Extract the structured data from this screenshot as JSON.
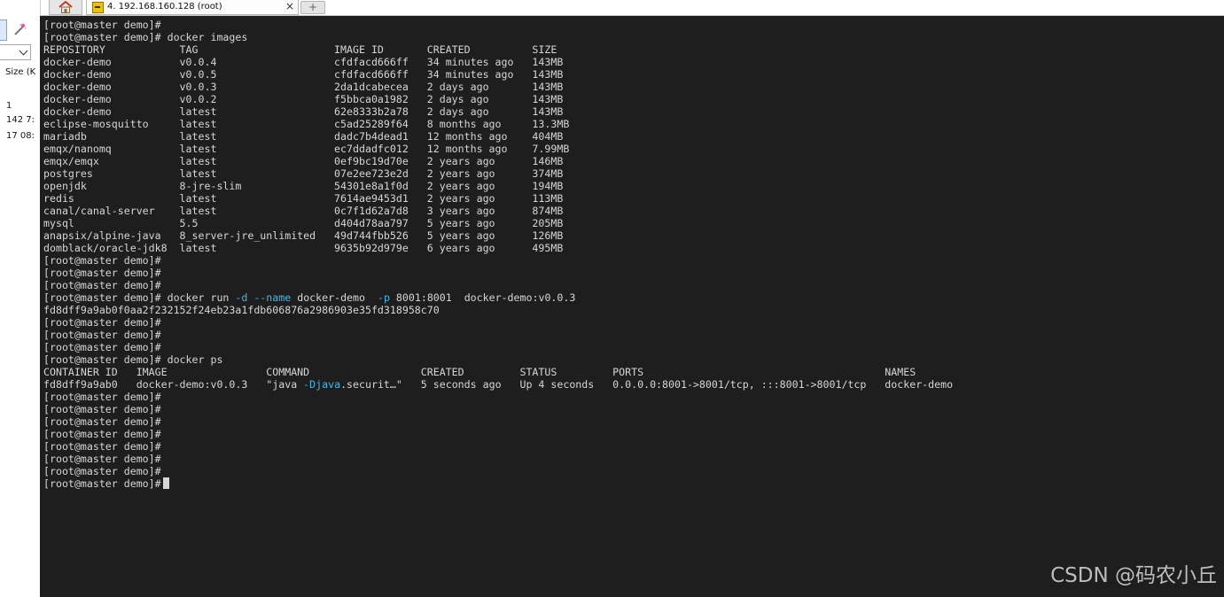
{
  "tabs": {
    "home_icon": "home-icon",
    "active_title": "4. 192.168.160.128 (root)",
    "close_glyph": "×",
    "new_tab_glyph": "+"
  },
  "sidebar": {
    "size_label": "Size (K",
    "rows": [
      "1",
      "142 7:",
      "17 08:"
    ]
  },
  "terminal": {
    "prompt": "[root@master demo]#",
    "lines": [
      "[root@master demo]#",
      "[root@master demo]# docker images",
      "REPOSITORY            TAG                      IMAGE ID       CREATED          SIZE",
      "docker-demo           v0.0.4                   cfdfacd666ff   34 minutes ago   143MB",
      "docker-demo           v0.0.5                   cfdfacd666ff   34 minutes ago   143MB",
      "docker-demo           v0.0.3                   2da1dcabecea   2 days ago       143MB",
      "docker-demo           v0.0.2                   f5bbca0a1982   2 days ago       143MB",
      "docker-demo           latest                   62e8333b2a78   2 days ago       143MB",
      "eclipse-mosquitto     latest                   c5ad25289f64   8 months ago     13.3MB",
      "mariadb               latest                   dadc7b4dead1   12 months ago    404MB",
      "emqx/nanomq           latest                   ec7ddadfc012   12 months ago    7.99MB",
      "emqx/emqx             latest                   0ef9bc19d70e   2 years ago      146MB",
      "postgres              latest                   07e2ee723e2d   2 years ago      374MB",
      "openjdk               8-jre-slim               54301e8a1f0d   2 years ago      194MB",
      "redis                 latest                   7614ae9453d1   2 years ago      113MB",
      "canal/canal-server    latest                   0c7f1d62a7d8   3 years ago      874MB",
      "mysql                 5.5                      d404d78aa797   5 years ago      205MB",
      "anapsix/alpine-java   8_server-jre_unlimited   49d744fbb526   5 years ago      126MB",
      "domblack/oracle-jdk8  latest                   9635b92d979e   6 years ago      495MB",
      "[root@master demo]#",
      "[root@master demo]#",
      "[root@master demo]#",
      "[root@master demo]# docker run -d --name docker-demo  -p 8001:8001  docker-demo:v0.0.3",
      "fd8dff9a9ab0f0aa2f232152f24eb23a1fdb606876a2986903e35fd318958c70",
      "[root@master demo]#",
      "[root@master demo]#",
      "[root@master demo]#",
      "[root@master demo]# docker ps",
      "CONTAINER ID   IMAGE                COMMAND                  CREATED         STATUS         PORTS                                       NAMES",
      "fd8dff9a9ab0   docker-demo:v0.0.3   \"java -Djava.securit…\"   5 seconds ago   Up 4 seconds   0.0.0.0:8001->8001/tcp, :::8001->8001/tcp   docker-demo",
      "[root@master demo]#",
      "[root@master demo]#",
      "[root@master demo]#",
      "[root@master demo]#",
      "[root@master demo]#",
      "[root@master demo]#",
      "[root@master demo]#"
    ]
  },
  "watermark": "CSDN @码农小丘",
  "colors": {
    "terminal_bg": "#1e1e1e",
    "terminal_fg": "#d6d6d6",
    "option_highlight": "#48b6e6"
  }
}
